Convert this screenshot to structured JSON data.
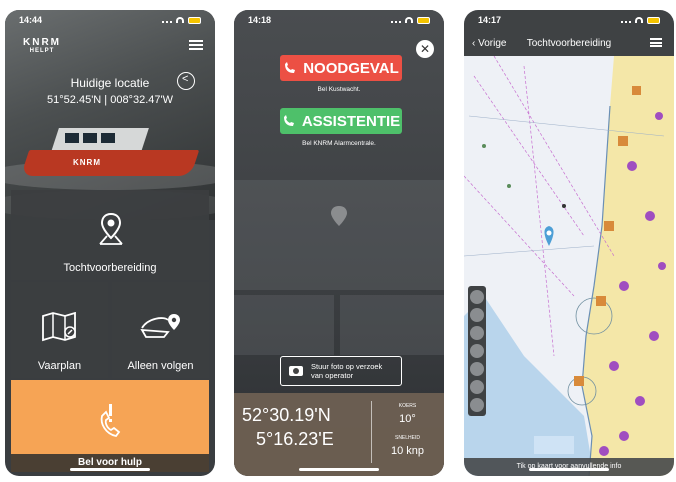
{
  "screen1": {
    "status": {
      "time": "14:44"
    },
    "logo": {
      "name": "KNRM",
      "tag": "HELPT"
    },
    "location": {
      "title": "Huidige locatie",
      "coords": "51°52.45'N | 008°32.47'W"
    },
    "boat_mark": "KNRM",
    "tiles": {
      "plan_label": "Tochtvoorbereiding",
      "vaarplan_label": "Vaarplan",
      "volgen_label": "Alleen volgen"
    },
    "help_label": "Bel voor hulp"
  },
  "screen2": {
    "status": {
      "time": "14:18"
    },
    "noodgeval": {
      "label": "NOODGEVAL",
      "sub": "Bel Kustwacht."
    },
    "assistentie": {
      "label": "ASSISTENTIE",
      "sub": "Bel KNRM Alarmcentrale."
    },
    "photo": {
      "line1": "Stuur foto op verzoek",
      "line2": "van operator"
    },
    "position": {
      "lat": "52°30.19'N",
      "lon": "5°16.23'E"
    },
    "koers": {
      "key": "KOERS",
      "value": "10°"
    },
    "snelheid": {
      "key": "SNELHEID",
      "value": "10 knp"
    }
  },
  "screen3": {
    "status": {
      "time": "14:17"
    },
    "nav": {
      "back": "Vorige",
      "title": "Tochtvoorbereiding"
    },
    "hint": "Tik op kaart voor aanvullende info"
  },
  "colors": {
    "help_orange": "#f6a455",
    "nood_red": "#ec5044",
    "assist_green": "#4ec06a",
    "sea_blue": "#b9d5ec",
    "land_yellow": "#f4e7a8"
  }
}
